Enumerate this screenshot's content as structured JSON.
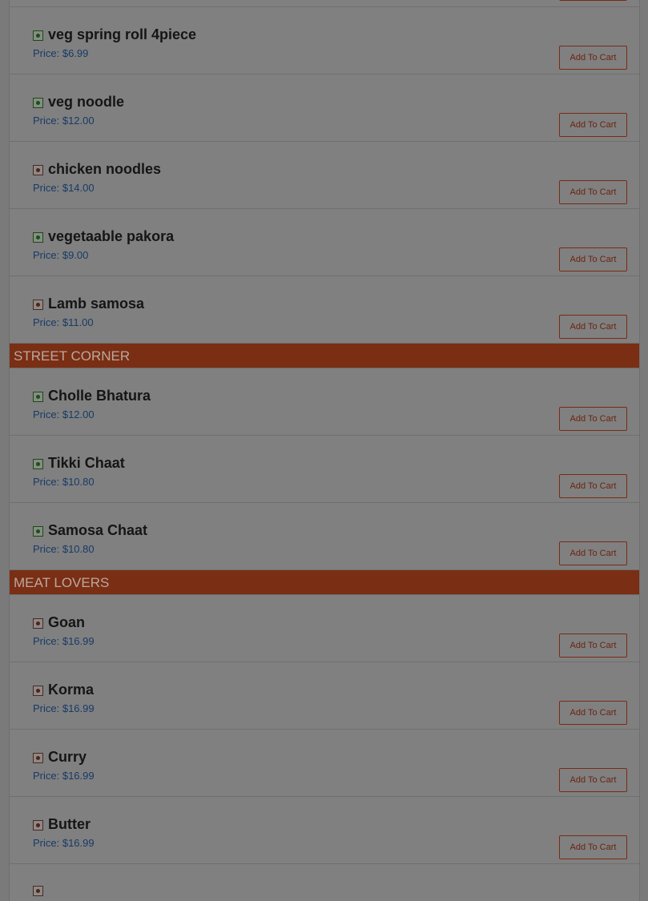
{
  "sections": [
    {
      "id": "top",
      "header": "",
      "items": [
        {
          "name": "veg spring roll 4piece",
          "price": "Price: $6.99",
          "veg": true,
          "button": "Add To Cart"
        },
        {
          "name": "veg noodle",
          "price": "Price: $12.00",
          "veg": true,
          "button": "Add To Cart"
        },
        {
          "name": "chicken noodles",
          "price": "Price: $14.00",
          "veg": false,
          "button": "Add To Cart"
        },
        {
          "name": "vegetaable pakora",
          "price": "Price: $9.00",
          "veg": true,
          "button": "Add To Cart"
        },
        {
          "name": "Lamb samosa",
          "price": "Price: $11.00",
          "veg": false,
          "button": "Add To Cart"
        }
      ]
    },
    {
      "id": "street-corner",
      "header": "STREET CORNER",
      "items": [
        {
          "name": "Cholle Bhatura",
          "price": "Price: $12.00",
          "veg": true,
          "button": "Add To Cart"
        },
        {
          "name": "Tikki Chaat",
          "price": "Price: $10.80",
          "veg": true,
          "button": "Add To Cart"
        },
        {
          "name": "Samosa Chaat",
          "price": "Price: $10.80",
          "veg": true,
          "button": "Add To Cart"
        }
      ]
    },
    {
      "id": "meat-lovers",
      "header": "MEAT LOVERS",
      "items": [
        {
          "name": "Goan",
          "price": "Price: $16.99",
          "veg": false,
          "button": "Add To Cart"
        },
        {
          "name": "Korma",
          "price": "Price: $16.99",
          "veg": false,
          "button": "Add To Cart"
        },
        {
          "name": "Curry",
          "price": "Price: $16.99",
          "veg": false,
          "button": "Add To Cart"
        },
        {
          "name": "Butter",
          "price": "Price: $16.99",
          "veg": false,
          "button": "Add To Cart"
        }
      ]
    }
  ],
  "colors": {
    "overlay": "#808080",
    "section_header_bg": "#7a2e14",
    "price_text": "#173a66",
    "veg_dot": "#0c5a06",
    "nonveg_dot": "#5c1f10"
  },
  "icons": {
    "veg": "veg-indicator-icon",
    "nonveg": "non-veg-indicator-icon"
  }
}
